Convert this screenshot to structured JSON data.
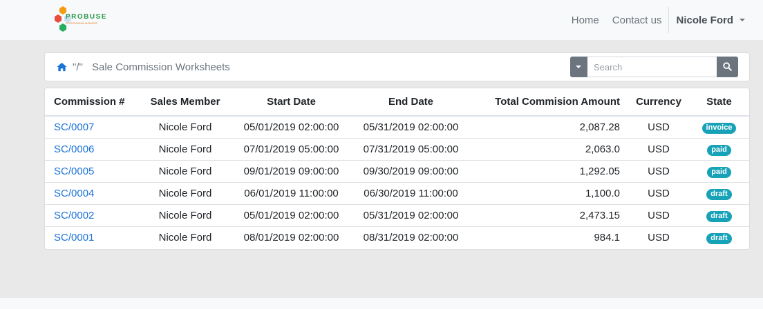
{
  "brand": {
    "name": "PROBUSE",
    "tagline": "PROFESSIONAL BUSINESS"
  },
  "nav": {
    "home": "Home",
    "contact": "Contact us",
    "user": "Nicole Ford"
  },
  "breadcrumb": {
    "separator": "\"/\"",
    "current": "Sale Commission Worksheets"
  },
  "search": {
    "placeholder": "Search"
  },
  "table": {
    "headers": [
      "Commission #",
      "Sales Member",
      "Start Date",
      "End Date",
      "Total Commision Amount",
      "Currency",
      "State"
    ],
    "rows": [
      {
        "number": "SC/0007",
        "member": "Nicole Ford",
        "start": "05/01/2019 02:00:00",
        "end": "05/31/2019 02:00:00",
        "amount": "2,087.28",
        "currency": "USD",
        "state": "invoice"
      },
      {
        "number": "SC/0006",
        "member": "Nicole Ford",
        "start": "07/01/2019 05:00:00",
        "end": "07/31/2019 05:00:00",
        "amount": "2,063.0",
        "currency": "USD",
        "state": "paid"
      },
      {
        "number": "SC/0005",
        "member": "Nicole Ford",
        "start": "09/01/2019 09:00:00",
        "end": "09/30/2019 09:00:00",
        "amount": "1,292.05",
        "currency": "USD",
        "state": "paid"
      },
      {
        "number": "SC/0004",
        "member": "Nicole Ford",
        "start": "06/01/2019 11:00:00",
        "end": "06/30/2019 11:00:00",
        "amount": "1,100.0",
        "currency": "USD",
        "state": "draft"
      },
      {
        "number": "SC/0002",
        "member": "Nicole Ford",
        "start": "05/01/2019 02:00:00",
        "end": "05/31/2019 02:00:00",
        "amount": "2,473.15",
        "currency": "USD",
        "state": "draft"
      },
      {
        "number": "SC/0001",
        "member": "Nicole Ford",
        "start": "08/01/2019 02:00:00",
        "end": "08/31/2019 02:00:00",
        "amount": "984.1",
        "currency": "USD",
        "state": "draft"
      }
    ]
  },
  "colors": {
    "link": "#1a73d8",
    "badge": "#17a2b8",
    "button": "#6c757d"
  }
}
